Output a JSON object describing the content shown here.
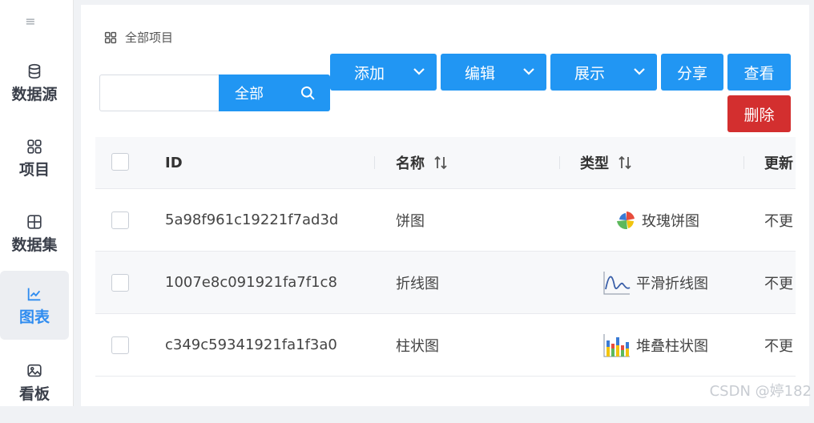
{
  "sidebar": {
    "items": [
      {
        "label": "数据源",
        "icon": "database-icon",
        "active": false
      },
      {
        "label": "项目",
        "icon": "grid-icon",
        "active": false
      },
      {
        "label": "数据集",
        "icon": "table-icon",
        "active": false
      },
      {
        "label": "图表",
        "icon": "line-chart-icon",
        "active": true
      },
      {
        "label": "看板",
        "icon": "image-board-icon",
        "active": false
      }
    ]
  },
  "breadcrumb": {
    "label": "全部项目"
  },
  "search": {
    "value": "",
    "placeholder": "",
    "scope": "全部"
  },
  "toolbar": {
    "add": "添加",
    "edit": "编辑",
    "display": "展示",
    "share": "分享",
    "view": "查看",
    "delete": "删除"
  },
  "table": {
    "headers": {
      "id": "ID",
      "name": "名称",
      "type": "类型",
      "updated": "更新"
    },
    "rows": [
      {
        "id": "5a98f961c19221f7ad3d",
        "name": "饼图",
        "type": "玫瑰饼图",
        "type_icon": "rose-pie-icon",
        "updated": "不更"
      },
      {
        "id": "1007e8c091921fa7f1c8",
        "name": "折线图",
        "type": "平滑折线图",
        "type_icon": "smooth-line-icon",
        "updated": "不更"
      },
      {
        "id": "c349c59341921fa1f3a0",
        "name": "柱状图",
        "type": "堆叠柱状图",
        "type_icon": "stacked-bar-icon",
        "updated": "不更"
      }
    ]
  },
  "watermark": "CSDN @婷182",
  "colors": {
    "primary": "#2196f3",
    "danger": "#d32f2f",
    "active_nav": "#2f8cf0"
  }
}
